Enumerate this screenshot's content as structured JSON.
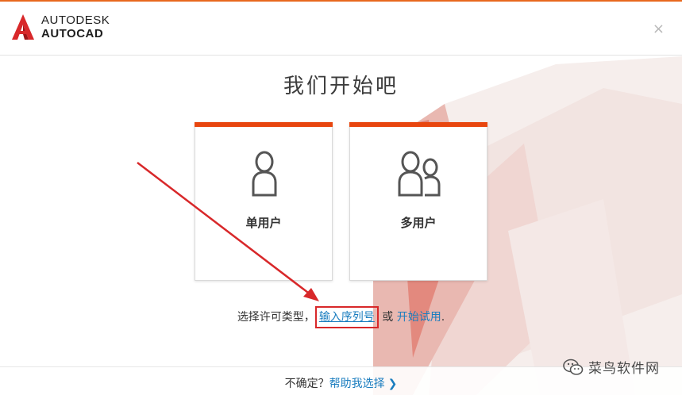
{
  "header": {
    "brand_line1": "AUTODESK",
    "brand_line2": "AUTOCAD",
    "close_glyph": "×"
  },
  "main": {
    "title": "我们开始吧",
    "cards": [
      {
        "label": "单用户",
        "icon": "single-user-icon"
      },
      {
        "label": "多用户",
        "icon": "multi-user-icon"
      }
    ],
    "license": {
      "prefix": "选择许可类型，",
      "serial_link": "输入序列号",
      "or_text": " 或 ",
      "trial_link": "开始试用",
      "suffix": "."
    }
  },
  "footer": {
    "unsure_text": "不确定？",
    "help_link": "帮助我选择",
    "chevron": "❯"
  },
  "watermark": {
    "text": "菜鸟软件网"
  },
  "colors": {
    "accent": "#e8460f",
    "link": "#1a7dbf",
    "annotation": "#d8282a"
  }
}
